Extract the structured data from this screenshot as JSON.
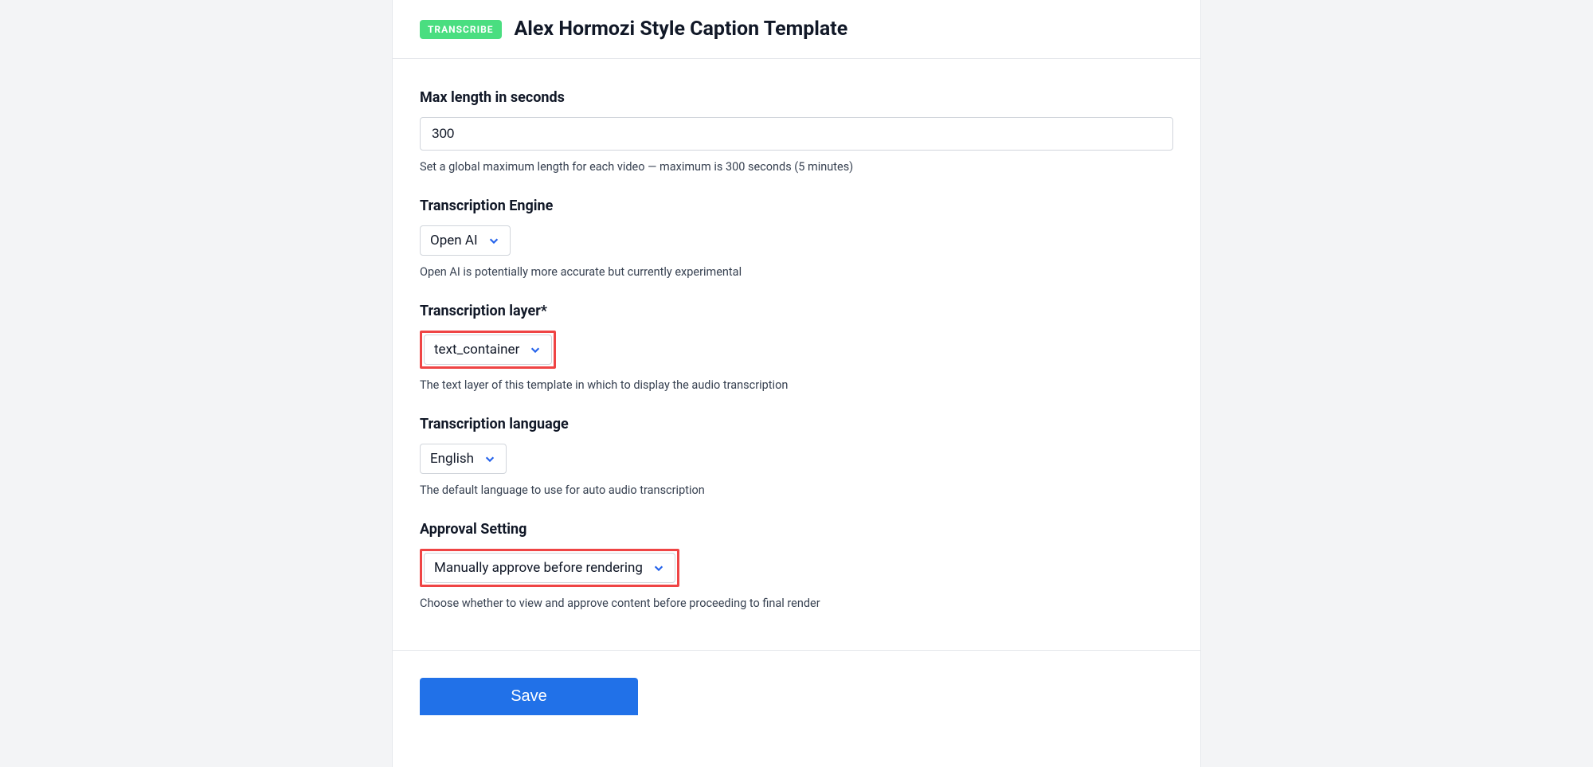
{
  "header": {
    "badge": "TRANSCRIBE",
    "title": "Alex Hormozi Style Caption Template"
  },
  "fields": {
    "max_length": {
      "label": "Max length in seconds",
      "value": "300",
      "helper": "Set a global maximum length for each video — maximum is 300 seconds (5 minutes)"
    },
    "engine": {
      "label": "Transcription Engine",
      "value": "Open AI",
      "helper": "Open AI is potentially more accurate but currently experimental"
    },
    "layer": {
      "label": "Transcription layer*",
      "value": "text_container",
      "helper": "The text layer of this template in which to display the audio transcription"
    },
    "language": {
      "label": "Transcription language",
      "value": "English",
      "helper": "The default language to use for auto audio transcription"
    },
    "approval": {
      "label": "Approval Setting",
      "value": "Manually approve before rendering",
      "helper": "Choose whether to view and approve content before proceeding to final render"
    }
  },
  "footer": {
    "save_label": "Save"
  }
}
